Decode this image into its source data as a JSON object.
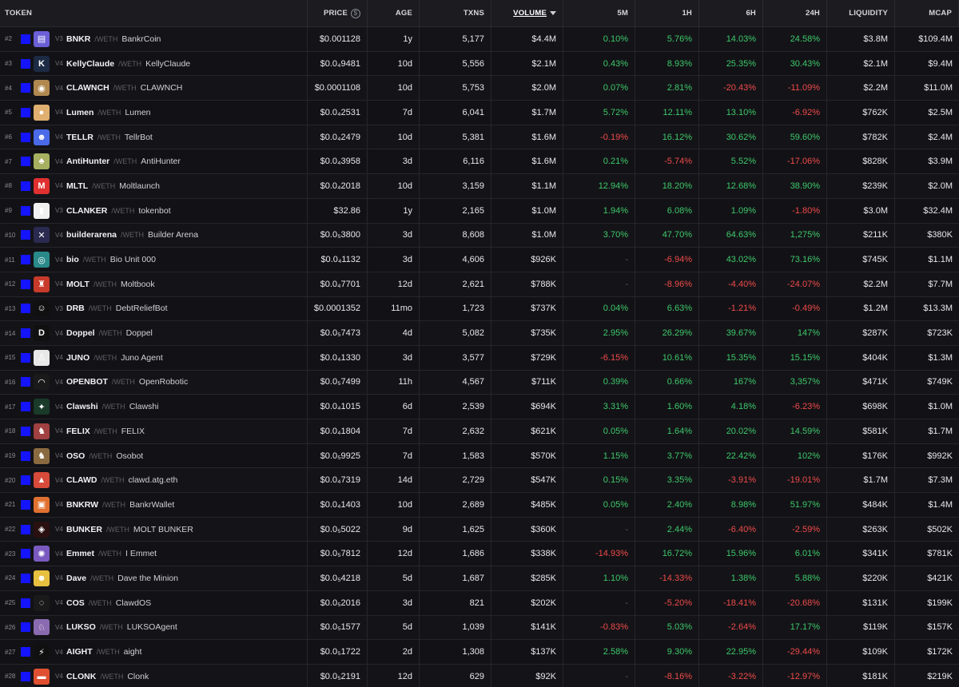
{
  "header": {
    "token": "TOKEN",
    "price": "PRICE",
    "price_icon": "$",
    "age": "AGE",
    "txns": "TXNS",
    "volume": "VOLUME",
    "m5": "5M",
    "h1": "1H",
    "h6": "6H",
    "h24": "24H",
    "liquidity": "LIQUIDITY",
    "mcap": "MCAP"
  },
  "colors": {
    "positive": "#3ec86a",
    "negative": "#f04a4a",
    "chain": "#1414ff"
  },
  "rows": [
    {
      "rank": "#2",
      "ver": "V3",
      "sym": "BNKR",
      "pair": "/WETH",
      "name": "BankrCoin",
      "price": "$0.001128",
      "age": "1y",
      "txns": "5,177",
      "vol": "$4.4M",
      "m5": "0.10%",
      "h1": "5.76%",
      "h6": "14.03%",
      "h24": "24.58%",
      "liq": "$3.8M",
      "mcap": "$109.4M",
      "av": "#6b5fd6",
      "ic": "▤"
    },
    {
      "rank": "#3",
      "ver": "V4",
      "sym": "KellyClaude",
      "pair": "/WETH",
      "name": "KellyClaude",
      "price": "$0.0₄9481",
      "age": "10d",
      "txns": "5,556",
      "vol": "$2.1M",
      "m5": "0.43%",
      "h1": "8.93%",
      "h6": "25.35%",
      "h24": "30.43%",
      "liq": "$2.1M",
      "mcap": "$9.4M",
      "av": "#1c2a44",
      "ic": "K"
    },
    {
      "rank": "#4",
      "ver": "V4",
      "sym": "CLAWNCH",
      "pair": "/WETH",
      "name": "CLAWNCH",
      "price": "$0.0001108",
      "age": "10d",
      "txns": "5,753",
      "vol": "$2.0M",
      "m5": "0.07%",
      "h1": "2.81%",
      "h6": "-20.43%",
      "h24": "-11.09%",
      "liq": "$2.2M",
      "mcap": "$11.0M",
      "av": "#b08850",
      "ic": "◉"
    },
    {
      "rank": "#5",
      "ver": "V4",
      "sym": "Lumen",
      "pair": "/WETH",
      "name": "Lumen",
      "price": "$0.0₄2531",
      "age": "7d",
      "txns": "6,041",
      "vol": "$1.7M",
      "m5": "5.72%",
      "h1": "12.11%",
      "h6": "13.10%",
      "h24": "-6.92%",
      "liq": "$762K",
      "mcap": "$2.5M",
      "av": "#e0b070",
      "ic": "●"
    },
    {
      "rank": "#6",
      "ver": "V4",
      "sym": "TELLR",
      "pair": "/WETH",
      "name": "TellrBot",
      "price": "$0.0₄2479",
      "age": "10d",
      "txns": "5,381",
      "vol": "$1.6M",
      "m5": "-0.19%",
      "h1": "16.12%",
      "h6": "30.62%",
      "h24": "59.60%",
      "liq": "$782K",
      "mcap": "$2.4M",
      "av": "#4a6ae8",
      "ic": "☻"
    },
    {
      "rank": "#7",
      "ver": "V4",
      "sym": "AntiHunter",
      "pair": "/WETH",
      "name": "AntiHunter",
      "price": "$0.0₄3958",
      "age": "3d",
      "txns": "6,116",
      "vol": "$1.6M",
      "m5": "0.21%",
      "h1": "-5.74%",
      "h6": "5.52%",
      "h24": "-17.06%",
      "liq": "$828K",
      "mcap": "$3.9M",
      "av": "#a6b060",
      "ic": "♣"
    },
    {
      "rank": "#8",
      "ver": "V4",
      "sym": "MLTL",
      "pair": "/WETH",
      "name": "Moltlaunch",
      "price": "$0.0₄2018",
      "age": "10d",
      "txns": "3,159",
      "vol": "$1.1M",
      "m5": "12.94%",
      "h1": "18.20%",
      "h6": "12.68%",
      "h24": "38.90%",
      "liq": "$239K",
      "mcap": "$2.0M",
      "av": "#e03030",
      "ic": "M"
    },
    {
      "rank": "#9",
      "ver": "V3",
      "sym": "CLANKER",
      "pair": "/WETH",
      "name": "tokenbot",
      "price": "$32.86",
      "age": "1y",
      "txns": "2,165",
      "vol": "$1.0M",
      "m5": "1.94%",
      "h1": "6.08%",
      "h6": "1.09%",
      "h24": "-1.80%",
      "liq": "$3.0M",
      "mcap": "$32.4M",
      "av": "#f0f0f0",
      "ic": "▮"
    },
    {
      "rank": "#10",
      "ver": "V4",
      "sym": "builderarena",
      "pair": "/WETH",
      "name": "Builder Arena",
      "price": "$0.0₅3800",
      "age": "3d",
      "txns": "8,608",
      "vol": "$1.0M",
      "m5": "3.70%",
      "h1": "47.70%",
      "h6": "64.63%",
      "h24": "1,275%",
      "liq": "$211K",
      "mcap": "$380K",
      "av": "#2a2a50",
      "ic": "✕"
    },
    {
      "rank": "#11",
      "ver": "V4",
      "sym": "bio",
      "pair": "/WETH",
      "name": "Bio Unit 000",
      "price": "$0.0₄1132",
      "age": "3d",
      "txns": "4,606",
      "vol": "$926K",
      "m5": "-",
      "h1": "-6.94%",
      "h6": "43.02%",
      "h24": "73.16%",
      "liq": "$745K",
      "mcap": "$1.1M",
      "av": "#2a8a8a",
      "ic": "◎"
    },
    {
      "rank": "#12",
      "ver": "V4",
      "sym": "MOLT",
      "pair": "/WETH",
      "name": "Moltbook",
      "price": "$0.0₄7701",
      "age": "12d",
      "txns": "2,621",
      "vol": "$788K",
      "m5": "-",
      "h1": "-8.96%",
      "h6": "-4.40%",
      "h24": "-24.07%",
      "liq": "$2.2M",
      "mcap": "$7.7M",
      "av": "#c83a2a",
      "ic": "♜"
    },
    {
      "rank": "#13",
      "ver": "V3",
      "sym": "DRB",
      "pair": "/WETH",
      "name": "DebtReliefBot",
      "price": "$0.0001352",
      "age": "11mo",
      "txns": "1,723",
      "vol": "$737K",
      "m5": "0.04%",
      "h1": "6.63%",
      "h6": "-1.21%",
      "h24": "-0.49%",
      "liq": "$1.2M",
      "mcap": "$13.3M",
      "av": "#101010",
      "ic": "☺"
    },
    {
      "rank": "#14",
      "ver": "V4",
      "sym": "Doppel",
      "pair": "/WETH",
      "name": "Doppel",
      "price": "$0.0₅7473",
      "age": "4d",
      "txns": "5,082",
      "vol": "$735K",
      "m5": "2.95%",
      "h1": "26.29%",
      "h6": "39.67%",
      "h24": "147%",
      "liq": "$287K",
      "mcap": "$723K",
      "av": "#101010",
      "ic": "D"
    },
    {
      "rank": "#15",
      "ver": "V4",
      "sym": "JUNO",
      "pair": "/WETH",
      "name": "Juno Agent",
      "price": "$0.0₄1330",
      "age": "3d",
      "txns": "3,577",
      "vol": "$729K",
      "m5": "-6.15%",
      "h1": "10.61%",
      "h6": "15.35%",
      "h24": "15.15%",
      "liq": "$404K",
      "mcap": "$1.3M",
      "av": "#e8e8e8",
      "ic": "♙"
    },
    {
      "rank": "#16",
      "ver": "V4",
      "sym": "OPENBOT",
      "pair": "/WETH",
      "name": "OpenRobotic",
      "price": "$0.0₅7499",
      "age": "11h",
      "txns": "4,567",
      "vol": "$711K",
      "m5": "0.39%",
      "h1": "0.66%",
      "h6": "167%",
      "h24": "3,357%",
      "liq": "$471K",
      "mcap": "$749K",
      "av": "#1a1a1a",
      "ic": "◠"
    },
    {
      "rank": "#17",
      "ver": "V4",
      "sym": "Clawshi",
      "pair": "/WETH",
      "name": "Clawshi",
      "price": "$0.0₄1015",
      "age": "6d",
      "txns": "2,539",
      "vol": "$694K",
      "m5": "3.31%",
      "h1": "1.60%",
      "h6": "4.18%",
      "h24": "-6.23%",
      "liq": "$698K",
      "mcap": "$1.0M",
      "av": "#1a3a2a",
      "ic": "✦"
    },
    {
      "rank": "#18",
      "ver": "V4",
      "sym": "FELIX",
      "pair": "/WETH",
      "name": "FELIX",
      "price": "$0.0₄1804",
      "age": "7d",
      "txns": "2,632",
      "vol": "$621K",
      "m5": "0.05%",
      "h1": "1.64%",
      "h6": "20.02%",
      "h24": "14.59%",
      "liq": "$581K",
      "mcap": "$1.7M",
      "av": "#a04040",
      "ic": "♞"
    },
    {
      "rank": "#19",
      "ver": "V4",
      "sym": "OSO",
      "pair": "/WETH",
      "name": "Osobot",
      "price": "$0.0₅9925",
      "age": "7d",
      "txns": "1,583",
      "vol": "$570K",
      "m5": "1.15%",
      "h1": "3.77%",
      "h6": "22.42%",
      "h24": "102%",
      "liq": "$176K",
      "mcap": "$992K",
      "av": "#8a6a40",
      "ic": "♞"
    },
    {
      "rank": "#20",
      "ver": "V4",
      "sym": "CLAWD",
      "pair": "/WETH",
      "name": "clawd.atg.eth",
      "price": "$0.0₄7319",
      "age": "14d",
      "txns": "2,729",
      "vol": "$547K",
      "m5": "0.15%",
      "h1": "3.35%",
      "h6": "-3.91%",
      "h24": "-19.01%",
      "liq": "$1.7M",
      "mcap": "$7.3M",
      "av": "#d84a3a",
      "ic": "▲"
    },
    {
      "rank": "#21",
      "ver": "V4",
      "sym": "BNKRW",
      "pair": "/WETH",
      "name": "BankrWallet",
      "price": "$0.0₄1403",
      "age": "10d",
      "txns": "2,689",
      "vol": "$485K",
      "m5": "0.05%",
      "h1": "2.40%",
      "h6": "8.98%",
      "h24": "51.97%",
      "liq": "$484K",
      "mcap": "$1.4M",
      "av": "#e07030",
      "ic": "▣"
    },
    {
      "rank": "#22",
      "ver": "V4",
      "sym": "BUNKER",
      "pair": "/WETH",
      "name": "MOLT BUNKER",
      "price": "$0.0₅5022",
      "age": "9d",
      "txns": "1,625",
      "vol": "$360K",
      "m5": "-",
      "h1": "2.44%",
      "h6": "-6.40%",
      "h24": "-2.59%",
      "liq": "$263K",
      "mcap": "$502K",
      "av": "#2a1010",
      "ic": "◈"
    },
    {
      "rank": "#23",
      "ver": "V4",
      "sym": "Emmet",
      "pair": "/WETH",
      "name": "I Emmet",
      "price": "$0.0₅7812",
      "age": "12d",
      "txns": "1,686",
      "vol": "$338K",
      "m5": "-14.93%",
      "h1": "16.72%",
      "h6": "15.96%",
      "h24": "6.01%",
      "liq": "$341K",
      "mcap": "$781K",
      "av": "#7a5ac0",
      "ic": "✺"
    },
    {
      "rank": "#24",
      "ver": "V4",
      "sym": "Dave",
      "pair": "/WETH",
      "name": "Dave the Minion",
      "price": "$0.0₅4218",
      "age": "5d",
      "txns": "1,687",
      "vol": "$285K",
      "m5": "1.10%",
      "h1": "-14.33%",
      "h6": "1.38%",
      "h24": "5.88%",
      "liq": "$220K",
      "mcap": "$421K",
      "av": "#e8c040",
      "ic": "☻"
    },
    {
      "rank": "#25",
      "ver": "V4",
      "sym": "COS",
      "pair": "/WETH",
      "name": "ClawdOS",
      "price": "$0.0₅2016",
      "age": "3d",
      "txns": "821",
      "vol": "$202K",
      "m5": "-",
      "h1": "-5.20%",
      "h6": "-18.41%",
      "h24": "-20.68%",
      "liq": "$131K",
      "mcap": "$199K",
      "av": "#1a1a1a",
      "ic": "◌"
    },
    {
      "rank": "#26",
      "ver": "V4",
      "sym": "LUKSO",
      "pair": "/WETH",
      "name": "LUKSOAgent",
      "price": "$0.0₅1577",
      "age": "5d",
      "txns": "1,039",
      "vol": "$141K",
      "m5": "-0.83%",
      "h1": "5.03%",
      "h6": "-2.64%",
      "h24": "17.17%",
      "liq": "$119K",
      "mcap": "$157K",
      "av": "#8a6ab0",
      "ic": "♘"
    },
    {
      "rank": "#27",
      "ver": "V4",
      "sym": "AIGHT",
      "pair": "/WETH",
      "name": "aight",
      "price": "$0.0₅1722",
      "age": "2d",
      "txns": "1,308",
      "vol": "$137K",
      "m5": "2.58%",
      "h1": "9.30%",
      "h6": "22.95%",
      "h24": "-29.44%",
      "liq": "$109K",
      "mcap": "$172K",
      "av": "#101010",
      "ic": "⚡"
    },
    {
      "rank": "#28",
      "ver": "V4",
      "sym": "CLONK",
      "pair": "/WETH",
      "name": "Clonk",
      "price": "$0.0₅2191",
      "age": "12d",
      "txns": "629",
      "vol": "$92K",
      "m5": "-",
      "h1": "-8.16%",
      "h6": "-3.22%",
      "h24": "-12.97%",
      "liq": "$181K",
      "mcap": "$219K",
      "av": "#e05030",
      "ic": "▬"
    }
  ]
}
